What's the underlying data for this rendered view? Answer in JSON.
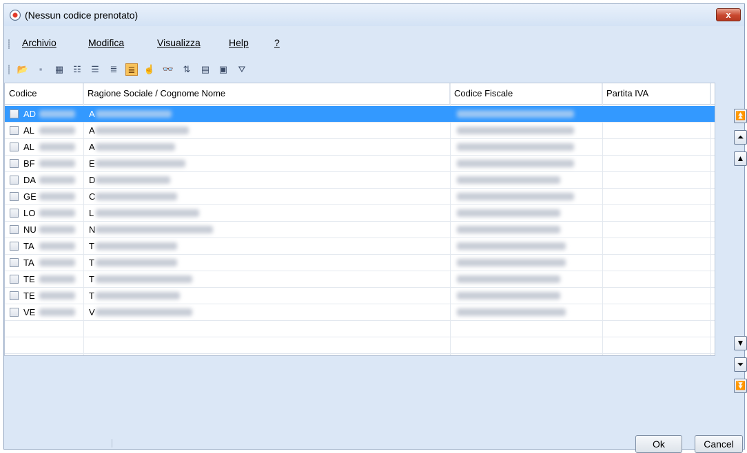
{
  "window": {
    "title": "(Nessun codice prenotato)",
    "close_label": "x"
  },
  "menu": {
    "items": [
      {
        "label": "Archivio"
      },
      {
        "label": "Modifica"
      },
      {
        "label": "Visualizza"
      },
      {
        "label": "Help"
      },
      {
        "label": "?"
      }
    ]
  },
  "toolbar": {
    "buttons": [
      {
        "name": "open-folder-icon",
        "glyph": "📂",
        "active": false
      },
      {
        "name": "save-disk-icon",
        "glyph": "▪",
        "active": false
      },
      {
        "name": "card-view-icon",
        "glyph": "▦",
        "active": false
      },
      {
        "name": "checklist-icon",
        "glyph": "☷",
        "active": false
      },
      {
        "name": "tree-view-icon",
        "glyph": "☰",
        "active": false
      },
      {
        "name": "detail-list-icon",
        "glyph": "≣",
        "active": false
      },
      {
        "name": "list-view-icon",
        "glyph": "≣",
        "active": true
      },
      {
        "name": "hand-pointer-icon",
        "glyph": "☝",
        "active": false
      },
      {
        "name": "binoculars-icon",
        "glyph": "👓",
        "active": false
      },
      {
        "name": "sort-az-icon",
        "glyph": "⇅",
        "active": false
      },
      {
        "name": "table-icon",
        "glyph": "▤",
        "active": false
      },
      {
        "name": "contact-card-icon",
        "glyph": "▣",
        "active": false
      },
      {
        "name": "filter-funnel-icon",
        "glyph": "⛛",
        "active": false
      }
    ]
  },
  "table": {
    "columns": [
      "Codice",
      "Ragione Sociale / Cognome Nome",
      "Codice Fiscale",
      "Partita IVA"
    ],
    "rows": [
      {
        "code_prefix": "AD",
        "name_prefix": "A",
        "selected": true
      },
      {
        "code_prefix": "AL",
        "name_prefix": "A",
        "selected": false
      },
      {
        "code_prefix": "AL",
        "name_prefix": "A",
        "selected": false
      },
      {
        "code_prefix": "BF",
        "name_prefix": "E",
        "selected": false
      },
      {
        "code_prefix": "DA",
        "name_prefix": "D",
        "selected": false
      },
      {
        "code_prefix": "GE",
        "name_prefix": "C",
        "selected": false
      },
      {
        "code_prefix": "LO",
        "name_prefix": "L",
        "selected": false
      },
      {
        "code_prefix": "NU",
        "name_prefix": "N",
        "selected": false
      },
      {
        "code_prefix": "TA",
        "name_prefix": "T",
        "selected": false
      },
      {
        "code_prefix": "TA",
        "name_prefix": "T",
        "selected": false
      },
      {
        "code_prefix": "TE",
        "name_prefix": "T",
        "selected": false
      },
      {
        "code_prefix": "TE",
        "name_prefix": "T",
        "selected": false
      },
      {
        "code_prefix": "VE",
        "name_prefix": "V",
        "selected": false
      }
    ]
  },
  "navigation": {
    "buttons": [
      {
        "name": "first-page-button",
        "glyph": "⏫"
      },
      {
        "name": "page-up-button",
        "glyph": "⏶"
      },
      {
        "name": "row-up-button",
        "glyph": "▲"
      },
      {
        "name": "row-down-button",
        "glyph": "▼"
      },
      {
        "name": "page-down-button",
        "glyph": "⏷"
      },
      {
        "name": "last-page-button",
        "glyph": "⏬"
      }
    ]
  },
  "actions": {
    "ok_label": "Ok",
    "cancel_label": "Cancel"
  }
}
